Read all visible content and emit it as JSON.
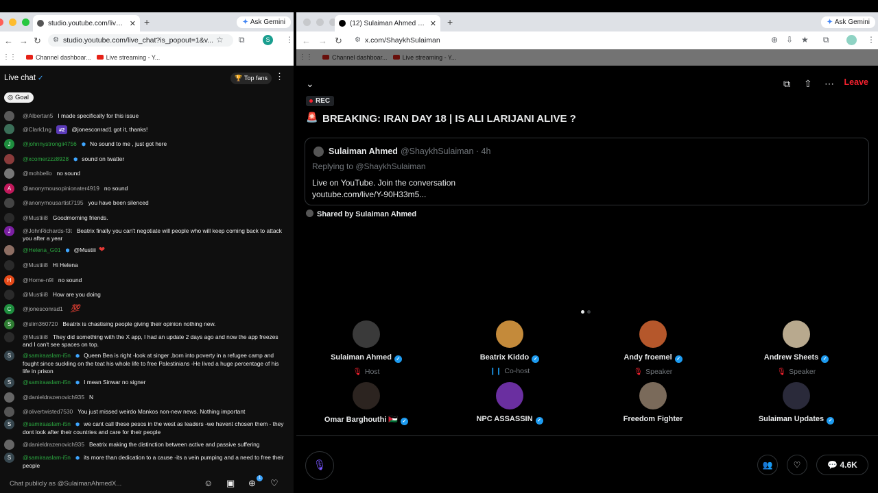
{
  "left_window": {
    "tab_title": "studio.youtube.com/live_chat",
    "ask_gemini": "Ask Gemini",
    "url": "studio.youtube.com/live_chat?is_popout=1&v...",
    "profile_letter": "S",
    "bookmarks": [
      "Channel dashboar...",
      "Live streaming - Y..."
    ],
    "live_chat_title": "Live chat",
    "top_fans": "Top fans",
    "goal": "Goal",
    "messages": [
      {
        "author": "@Albertan5",
        "text": "I made specifically for this issue",
        "avatar_letter": "",
        "avatar_color": "#5a5a5a"
      },
      {
        "author": "@Clark1ng",
        "badge": "#2",
        "text": "@jonesconrad1 got it, thanks!",
        "avatar_letter": "",
        "avatar_color": "#3b6e58"
      },
      {
        "author": "@johnnystrongii4756",
        "text": "No sound to me , just got here",
        "avatar_letter": "J",
        "avatar_color": "#1e8e3e",
        "green": true,
        "member": true
      },
      {
        "author": "@xcomerzzz8928",
        "text": "sound on twatter",
        "avatar_letter": "",
        "avatar_color": "#8a3b3b",
        "green": true,
        "member": true
      },
      {
        "author": "@mohbello",
        "text": "no sound",
        "avatar_letter": "",
        "avatar_color": "#777777"
      },
      {
        "author": "@anonymousopinionater4919",
        "text": "no sound",
        "avatar_letter": "A",
        "avatar_color": "#c2185b"
      },
      {
        "author": "@anonymousartist7195",
        "text": "you have been silenced",
        "avatar_letter": "",
        "avatar_color": "#444444"
      },
      {
        "author": "@Mustiii8",
        "text": "Goodmorning friends.",
        "avatar_letter": "",
        "avatar_color": "#2a2a2a"
      },
      {
        "author": "@JohnRichards-f3t",
        "text": "Beatrix finally you can't negotiate will people who will keep coming back to attack you after a year",
        "avatar_letter": "J",
        "avatar_color": "#7b1fa2"
      },
      {
        "author": "@Helena_G01",
        "text": "@Mustiii",
        "avatar_letter": "",
        "avatar_color": "#8d6e63",
        "green": true,
        "member": true,
        "emoji": "❤"
      },
      {
        "author": "@Mustiii8",
        "text": "Hi Helena",
        "avatar_letter": "",
        "avatar_color": "#2a2a2a"
      },
      {
        "author": "@Home-n9l",
        "text": "no sound",
        "avatar_letter": "H",
        "avatar_color": "#e64a19"
      },
      {
        "author": "@Mustiii8",
        "text": "How are you doing",
        "avatar_letter": "",
        "avatar_color": "#2a2a2a"
      },
      {
        "author": "@jonesconrad1",
        "text": "",
        "avatar_letter": "C",
        "avatar_color": "#1e8e3e",
        "emoji": "💯",
        "emoji_hun": true
      },
      {
        "author": "@slim360720",
        "text": "Beatrix is chastising people giving their opinion nothing new.",
        "avatar_letter": "S",
        "avatar_color": "#2e7d32"
      },
      {
        "author": "@Mustiii8",
        "text": "They did something with the X app, I had an update 2 days ago and now the app freezes and I can't see spaces on top.",
        "avatar_letter": "",
        "avatar_color": "#2a2a2a"
      },
      {
        "author": "@samiraaslam-i5n",
        "text": "Queen Bea is right -look at singer ,born into poverty in a refugee camp and fought since suckling on the teat his whole life to free Palestinians -He lived a huge percentage of his life in prison",
        "avatar_letter": "S",
        "avatar_color": "#37474f",
        "green": true,
        "member": true
      },
      {
        "author": "@samiraaslam-i5n",
        "text": "I mean Sinwar no signer",
        "avatar_letter": "S",
        "avatar_color": "#37474f",
        "green": true,
        "member": true
      },
      {
        "author": "@danieldrazenovich935",
        "text": "N",
        "avatar_letter": "",
        "avatar_color": "#666666"
      },
      {
        "author": "@olivertwisted7530",
        "text": "You just missed weirdo Mankos non-new news. Nothing important",
        "avatar_letter": "",
        "avatar_color": "#555555"
      },
      {
        "author": "@samiraaslam-i5n",
        "text": "we cant call these pesos in the west as leaders -we havent chosen them - they dont look after their countries and care for their people",
        "avatar_letter": "S",
        "avatar_color": "#37474f",
        "green": true,
        "member": true
      },
      {
        "author": "@danieldrazenovich935",
        "text": "Beatrix making the distinction between active and passive suffering",
        "avatar_letter": "",
        "avatar_color": "#666666"
      },
      {
        "author": "@samiraaslam-i5n",
        "text": "its more than dedication to a cause -its a vein pumping and a need to free their people",
        "avatar_letter": "S",
        "avatar_color": "#37474f",
        "green": true,
        "member": true
      }
    ],
    "chat_placeholder": "Chat publicly as @SulaimanAhmedX...",
    "notification_count": "1"
  },
  "right_window": {
    "tab_title": "(12) Sulaiman Ahmed (@ShaykhSulaiman) / X",
    "ask_gemini": "Ask Gemini",
    "url": "x.com/ShaykhSulaiman",
    "bookmarks": [
      "Channel dashboar...",
      "Live streaming - Y..."
    ],
    "leave": "Leave",
    "rec": "REC",
    "headline": "BREAKING: IRAN DAY 18 | IS ALI LARIJANI ALIVE ?",
    "tweet": {
      "name": "Sulaiman Ahmed",
      "handle": "@ShaykhSulaiman · 4h",
      "replying": "Replying to @ShaykhSulaiman",
      "line1": "Live on YouTube. Join the conversation",
      "line2": "youtube.com/live/Y-90H33m5..."
    },
    "shared_by": "Shared by Sulaiman Ahmed",
    "speakers": [
      {
        "name": "Sulaiman Ahmed",
        "role": "Host",
        "color": "#3a3a3a",
        "verified": true
      },
      {
        "name": "Beatrix Kiddo",
        "role": "Co-host",
        "color": "#c48a3a",
        "verified": true
      },
      {
        "name": "Andy froemel",
        "role": "Speaker",
        "color": "#b5572b",
        "verified": true
      },
      {
        "name": "Andrew Sheets",
        "role": "Speaker",
        "color": "#b8a98e",
        "verified": true
      },
      {
        "name": "Omar Barghouthi 🇯🇴",
        "role": "",
        "color": "#2c2420",
        "verified": true
      },
      {
        "name": "NPC ASSASSIN",
        "role": "",
        "color": "#6a2fa0",
        "verified": true
      },
      {
        "name": "Freedom Fighter",
        "role": "",
        "color": "#7a6a5a",
        "verified": false
      },
      {
        "name": "Sulaiman Updates",
        "role": "",
        "color": "#2a2a3a",
        "verified": true
      }
    ],
    "listener_count": "4.6K"
  }
}
